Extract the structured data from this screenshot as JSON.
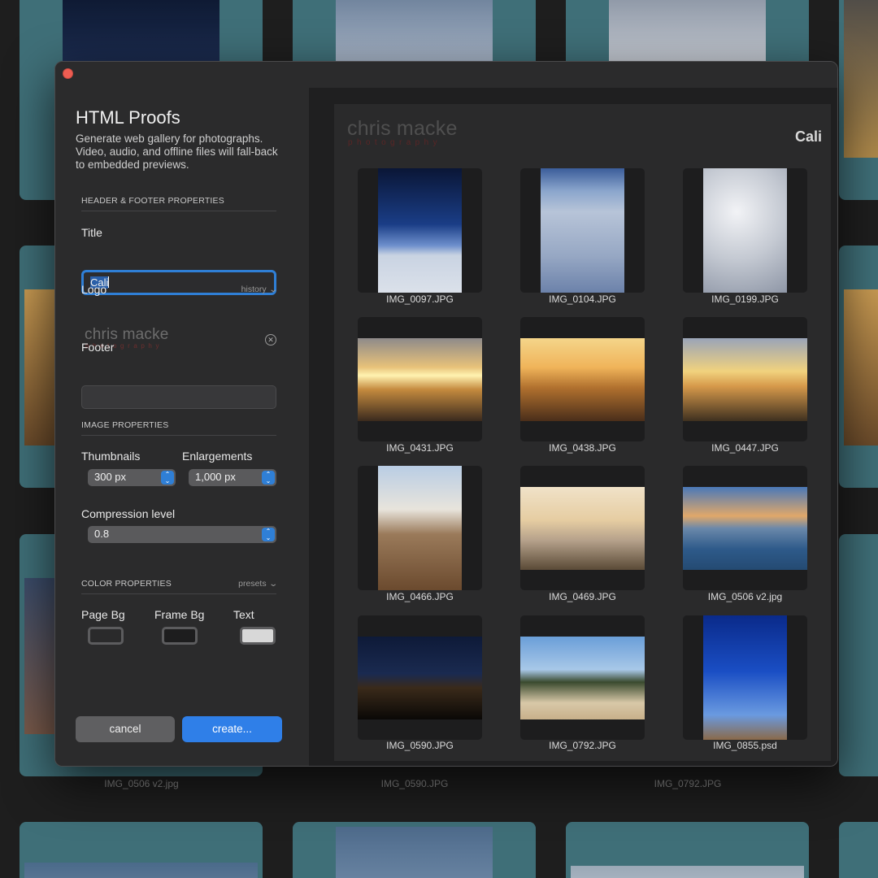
{
  "background": {
    "captions": [
      "IMG_0506 v2.jpg",
      "IMG_0590.JPG",
      "IMG_0792.JPG"
    ]
  },
  "dialog": {
    "title": "HTML Proofs",
    "description": "Generate web gallery for photographs. Video, audio, and offline files will fall-back to embedded previews.",
    "header_footer": {
      "section_label": "HEADER & FOOTER PROPERTIES",
      "title_label": "Title",
      "title_value": "Cali",
      "logo_label": "Logo",
      "history_label": "history",
      "logo_text": "chris macke",
      "logo_subtext": "photography",
      "footer_label": "Footer",
      "footer_value": ""
    },
    "image": {
      "section_label": "IMAGE PROPERTIES",
      "thumbnails_label": "Thumbnails",
      "thumbnails_value": "300 px",
      "enlargements_label": "Enlargements",
      "enlargements_value": "1,000 px",
      "compression_label": "Compression level",
      "compression_value": "0.8"
    },
    "color": {
      "section_label": "COLOR PROPERTIES",
      "presets_label": "presets",
      "page_bg_label": "Page Bg",
      "frame_bg_label": "Frame Bg",
      "text_label": "Text",
      "page_bg_color": "#2a2a2b",
      "frame_bg_color": "#1d1d1e",
      "text_color": "#d8d8d8"
    },
    "buttons": {
      "cancel": "cancel",
      "create": "create..."
    }
  },
  "preview": {
    "logo_text": "chris macke",
    "logo_subtext": "photography",
    "title": "Cali",
    "images": [
      "IMG_0097.JPG",
      "IMG_0104.JPG",
      "IMG_0199.JPG",
      "IMG_0431.JPG",
      "IMG_0438.JPG",
      "IMG_0447.JPG",
      "IMG_0466.JPG",
      "IMG_0469.JPG",
      "IMG_0506 v2.jpg",
      "IMG_0590.JPG",
      "IMG_0792.JPG",
      "IMG_0855.psd"
    ]
  },
  "icons": {
    "close": "close-window-icon",
    "clear_logo": "clear-circle-icon",
    "dropdown": "chevron-down-icon",
    "stepper": "up-down-arrows-icon"
  }
}
